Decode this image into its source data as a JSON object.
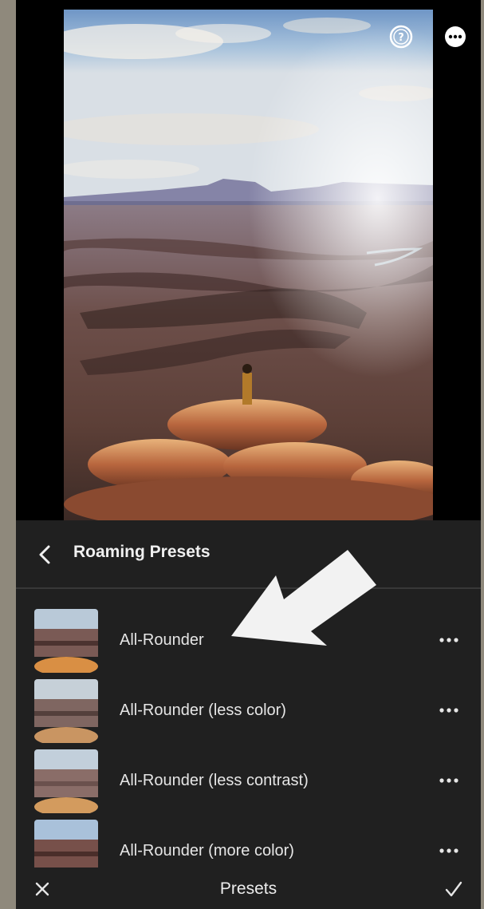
{
  "header": {
    "help_icon": "help-circle-icon",
    "more_icon": "more-horizontal-icon"
  },
  "panel": {
    "title": "Roaming Presets",
    "back_icon": "chevron-left-icon"
  },
  "presets": [
    {
      "label": "All-Rounder"
    },
    {
      "label": "All-Rounder (less color)"
    },
    {
      "label": "All-Rounder (less contrast)"
    },
    {
      "label": "All-Rounder (more color)"
    }
  ],
  "bottom_bar": {
    "title": "Presets",
    "close_icon": "close-icon",
    "confirm_icon": "check-icon"
  },
  "annotation": {
    "arrow_color": "#f2f2f2"
  },
  "colors": {
    "panel_bg": "#202020",
    "text": "#e6e6e6",
    "divider": "#383838"
  }
}
